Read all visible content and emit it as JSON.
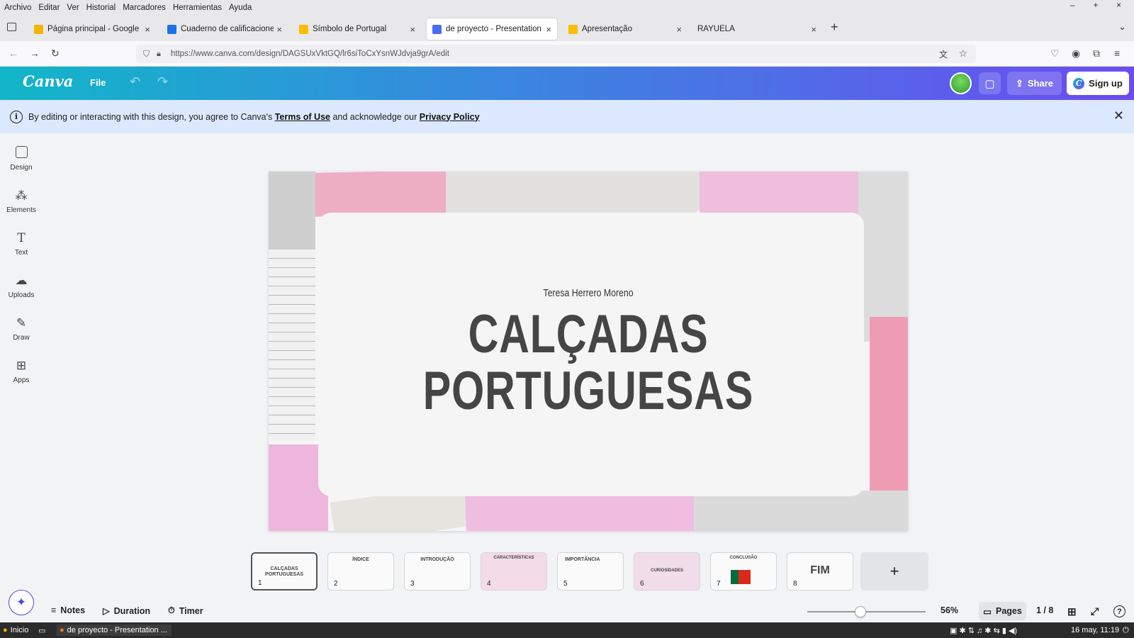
{
  "menubar": {
    "items": [
      "Archivo",
      "Editar",
      "Ver",
      "Historial",
      "Marcadores",
      "Herramientas",
      "Ayuda"
    ]
  },
  "window_controls": [
    "–",
    "+",
    "×"
  ],
  "tabs": [
    {
      "label": "Página principal - Google Drive",
      "fav": "#f4b400",
      "active": false
    },
    {
      "label": "Cuaderno de calificaciones de",
      "fav": "#1a73e8",
      "active": false
    },
    {
      "label": "Símbolo de Portugal",
      "fav": "#fbbc04",
      "active": false
    },
    {
      "label": "de proyecto - Presentation",
      "fav": "#4a6cf0",
      "active": true
    },
    {
      "label": "Apresentação",
      "fav": "#fbbc04",
      "active": false
    },
    {
      "label": "RAYUELA",
      "fav": "",
      "active": false
    }
  ],
  "url": "https://www.canva.com/design/DAGSUxVktGQ/lr6siToCxYsnWJdvja9grA/edit",
  "canva": {
    "logo": "Canva",
    "file": "File",
    "share": "Share",
    "signup": "Sign up"
  },
  "banner": {
    "text1": "By editing or interacting with this design, you agree to Canva's ",
    "link1": "Terms of Use",
    "text2": " and acknowledge our ",
    "link2": "Privacy Policy"
  },
  "rail": [
    "Design",
    "Elements",
    "Text",
    "Uploads",
    "Draw",
    "Apps"
  ],
  "slide": {
    "author": "Teresa Herrero Moreno",
    "title_line1": "CALÇADAS",
    "title_line2": "PORTUGUESAS"
  },
  "thumbnails": [
    {
      "num": "1",
      "text": "CALÇADAS PORTUGUESAS"
    },
    {
      "num": "2",
      "text": "ÍNDICE"
    },
    {
      "num": "3",
      "text": "INTRODUÇÃO"
    },
    {
      "num": "4",
      "text": "CARACTERÍSTICAS"
    },
    {
      "num": "5",
      "text": "IMPORTÂNCIA"
    },
    {
      "num": "6",
      "text": "CURIOSIDADES"
    },
    {
      "num": "7",
      "text": "CONCLUSÃO"
    },
    {
      "num": "8",
      "text": "FIM"
    }
  ],
  "bottom": {
    "notes": "Notes",
    "duration": "Duration",
    "timer": "Timer",
    "zoom": "56%",
    "pages": "Pages",
    "page_counter": "1 / 8"
  },
  "taskbar": {
    "start": "Inicio",
    "app": "de proyecto - Presentation ...",
    "clock": "16 may, 11:19"
  },
  "colors": {
    "canva_gradient_start": "#11b6c9",
    "canva_gradient_end": "#6b4cf0",
    "banner_bg": "#dce8fd",
    "title": "#454545"
  }
}
